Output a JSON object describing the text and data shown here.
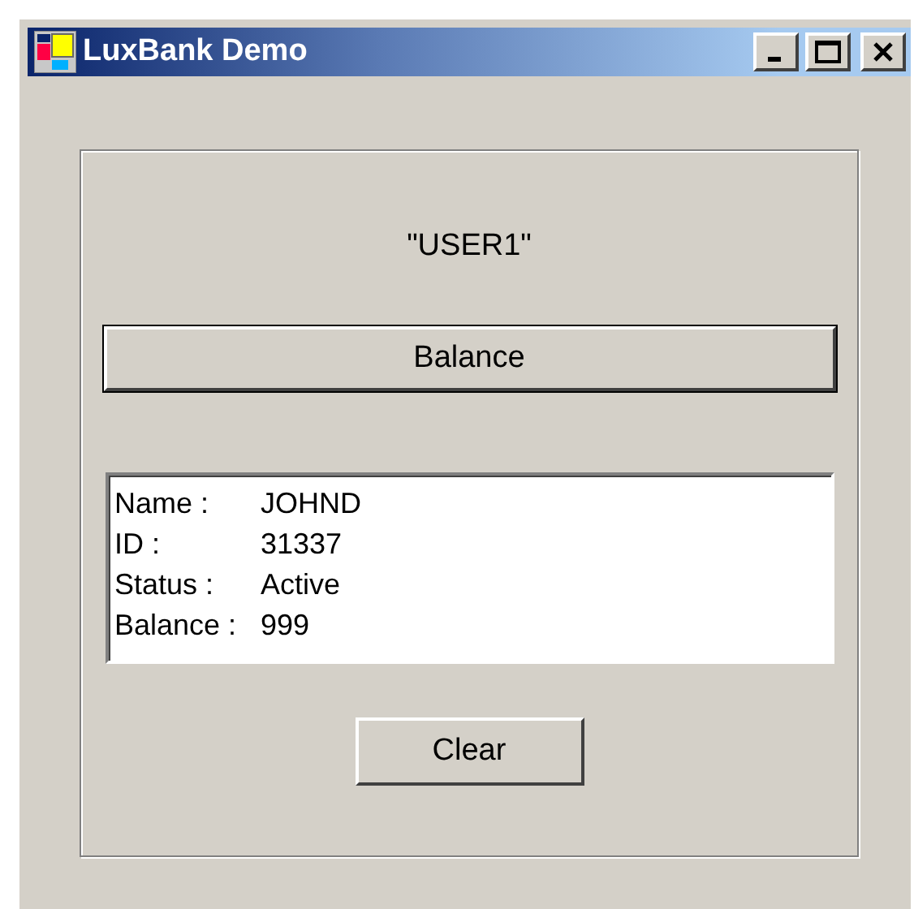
{
  "window": {
    "title": "LuxBank Demo"
  },
  "user_label": "\"USER1\"",
  "balance_button": "Balance",
  "details": [
    {
      "label": "Name :",
      "value": "JOHND"
    },
    {
      "label": "ID :",
      "value": "31337"
    },
    {
      "label": "Status :",
      "value": "Active"
    },
    {
      "label": "Balance :",
      "value": "999"
    }
  ],
  "clear_button": "Clear"
}
